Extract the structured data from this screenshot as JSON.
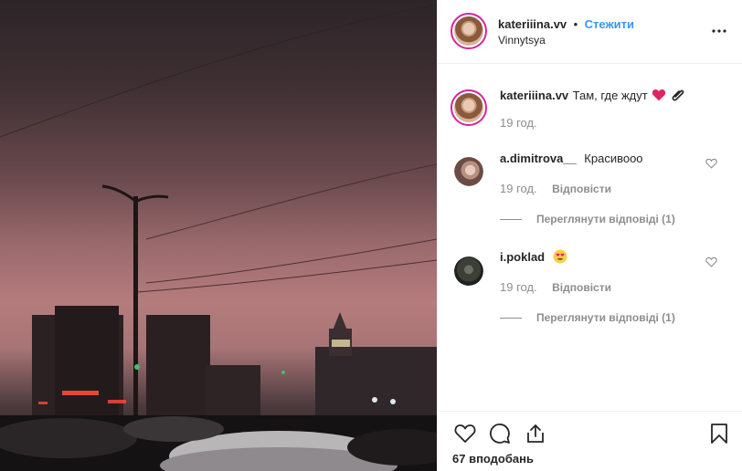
{
  "post": {
    "author": "kateriiina.vv",
    "separator": "•",
    "follow_label": "Стежити",
    "location": "Vinnytsya",
    "caption": {
      "username": "kateriiina.vv",
      "text": "Там, где ждут",
      "emoji": [
        "red-heart",
        "paperclip"
      ],
      "time": "19 год."
    }
  },
  "comments": [
    {
      "username": "a.dimitrova__",
      "text": "Красивооо",
      "time": "19 год.",
      "reply_label": "Відповісти",
      "view_replies": "Переглянути відповіді (1)"
    },
    {
      "username": "i.poklad",
      "text": "",
      "emoji": [
        "smiling-face-with-heart-eyes"
      ],
      "time": "19 год.",
      "reply_label": "Відповісти",
      "view_replies": "Переглянути відповіді (1)"
    }
  ],
  "actions": {
    "likes": "67 вподобань",
    "icons": [
      "heart-icon",
      "comment-icon",
      "share-icon",
      "bookmark-icon"
    ]
  },
  "colors": {
    "link_blue": "#3897f0",
    "muted": "#8e8e8e",
    "follow_ring": "#d6249f",
    "heart_red": "#e0245e"
  }
}
